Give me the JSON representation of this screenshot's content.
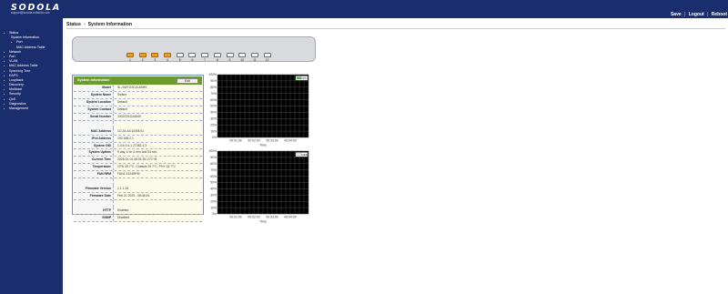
{
  "header": {
    "logo": "SODOLA",
    "tagline": "support@sodola-network.com",
    "links": [
      "Save",
      "Logout",
      "Reboot"
    ]
  },
  "breadcrumb": {
    "section": "Status",
    "separator": "»",
    "page": "System Information"
  },
  "menu": [
    {
      "label": "Status",
      "level": 0
    },
    {
      "label": "System Information",
      "level": 1
    },
    {
      "label": "Port",
      "level": 1
    },
    {
      "label": "MAC Address Table",
      "level": 2
    },
    {
      "label": "Network",
      "level": 0
    },
    {
      "label": "Port",
      "level": 0
    },
    {
      "label": "VLAN",
      "level": 0
    },
    {
      "label": "MAC Address Table",
      "level": 0
    },
    {
      "label": "Spanning Tree",
      "level": 0
    },
    {
      "label": "EAPS",
      "level": 0
    },
    {
      "label": "Loopback",
      "level": 0
    },
    {
      "label": "Discovery",
      "level": 0
    },
    {
      "label": "Multicast",
      "level": 0
    },
    {
      "label": "Security",
      "level": 0
    },
    {
      "label": "QoS",
      "level": 0
    },
    {
      "label": "Diagnostics",
      "level": 0
    },
    {
      "label": "Management",
      "level": 0
    }
  ],
  "ports": [
    {
      "label": "1",
      "link": "up"
    },
    {
      "label": "2",
      "link": "up"
    },
    {
      "label": "3",
      "link": "up"
    },
    {
      "label": "4",
      "link": "up"
    },
    {
      "label": "5",
      "link": "down"
    },
    {
      "label": "6",
      "link": "down"
    },
    {
      "label": "7",
      "link": "down"
    },
    {
      "label": "8",
      "link": "down"
    },
    {
      "label": "9",
      "link": "down"
    },
    {
      "label": "10",
      "link": "down"
    },
    {
      "label": "11",
      "link": "down"
    },
    {
      "label": "12",
      "link": "down"
    }
  ],
  "system_info": {
    "title": "System Information",
    "edit_label": "Edit",
    "rows": [
      {
        "label": "Model",
        "value": "SL-SWTG3C2L4BHS"
      },
      {
        "label": "System Name",
        "value": "Switch"
      },
      {
        "label": "System Location",
        "value": "Default"
      },
      {
        "label": "System Contact",
        "value": "Default"
      },
      {
        "label": "Serial Number",
        "value": "23022251116649"
      },
      {
        "label": "",
        "value": ""
      },
      {
        "label": "MAC Address",
        "value": "1C:2A:A3:10:E8:51"
      },
      {
        "label": "IPv4 Address",
        "value": "192.168.2.1"
      },
      {
        "label": "System OID",
        "value": "1.3.6.1.4.1.27282.1.3"
      },
      {
        "label": "System Uptime",
        "value": "0 day, 0 hr, 6 min and 33 sec"
      },
      {
        "label": "Current Time",
        "value": "2025-01-01 08:51:51 UTC+8"
      },
      {
        "label": "Temperature",
        "value": "CPU 39.7°C, Chassis 29.7°C, PHY 26.7°C"
      },
      {
        "label": "FAN RPM",
        "value": "FAN1 2424RPM"
      },
      {
        "label": "",
        "value": ""
      },
      {
        "label": "Firmware Version",
        "value": "1.1.1.34"
      },
      {
        "label": "Firmware Date",
        "value": "Feb 21 2025 - 08:48:24"
      },
      {
        "label": "",
        "value": ""
      },
      {
        "label": "HTTP",
        "value": "Enabled"
      },
      {
        "label": "SNMP",
        "value": "Disabled"
      }
    ]
  },
  "chart_data": [
    {
      "type": "line",
      "legend": [
        "CPU"
      ],
      "yticks": [
        "100%",
        "90%",
        "80%",
        "70%",
        "60%",
        "50%",
        "40%",
        "30%",
        "20%",
        "10%",
        "0%"
      ],
      "xticks": [
        "00:01:00",
        "00:02:00",
        "00:03:00",
        "00:04:00"
      ],
      "xlabel": "Time",
      "ylim": [
        0,
        100
      ],
      "grid": true,
      "x": [],
      "y": []
    },
    {
      "type": "line",
      "legend": [
        "MEM"
      ],
      "yticks": [
        "100%",
        "90%",
        "80%",
        "70%",
        "60%",
        "50%",
        "40%",
        "30%",
        "20%",
        "10%",
        "0%"
      ],
      "xticks": [
        "00:01:00",
        "00:02:00",
        "00:03:00",
        "00:04:00"
      ],
      "xlabel": "Time",
      "ylim": [
        0,
        100
      ],
      "grid": true,
      "x": [],
      "y": []
    }
  ],
  "colors": {
    "navy": "#1a2e6e",
    "panel_head_green": "#6a9b2c",
    "port_up": "#e8a127",
    "chart_bg": "#000000",
    "chart_grid": "#4a4a4a",
    "legend_cpu": "#33cc33"
  }
}
